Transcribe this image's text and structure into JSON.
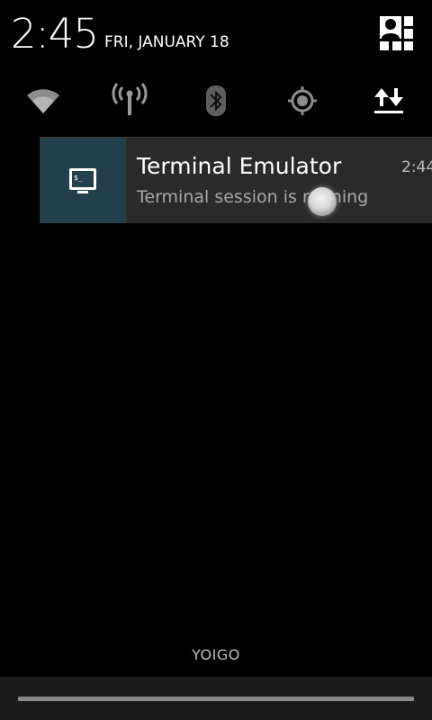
{
  "status": {
    "time": "2:45",
    "date": "FRI, JANUARY 18"
  },
  "quick_settings": [
    {
      "icon": "wifi-icon"
    },
    {
      "icon": "mobile-signal-icon"
    },
    {
      "icon": "bluetooth-icon"
    },
    {
      "icon": "gps-icon"
    },
    {
      "icon": "data-sync-icon"
    }
  ],
  "notification": {
    "icon": "terminal-icon",
    "title": "Terminal Emulator",
    "time": "2:44",
    "text": "Terminal session is running"
  },
  "carrier": "YOIGO",
  "colors": {
    "background": "#000000",
    "notification_bg": "#2a2a2a",
    "notification_icon_bg": "#23404d",
    "secondary_text": "#a8a8a8"
  }
}
